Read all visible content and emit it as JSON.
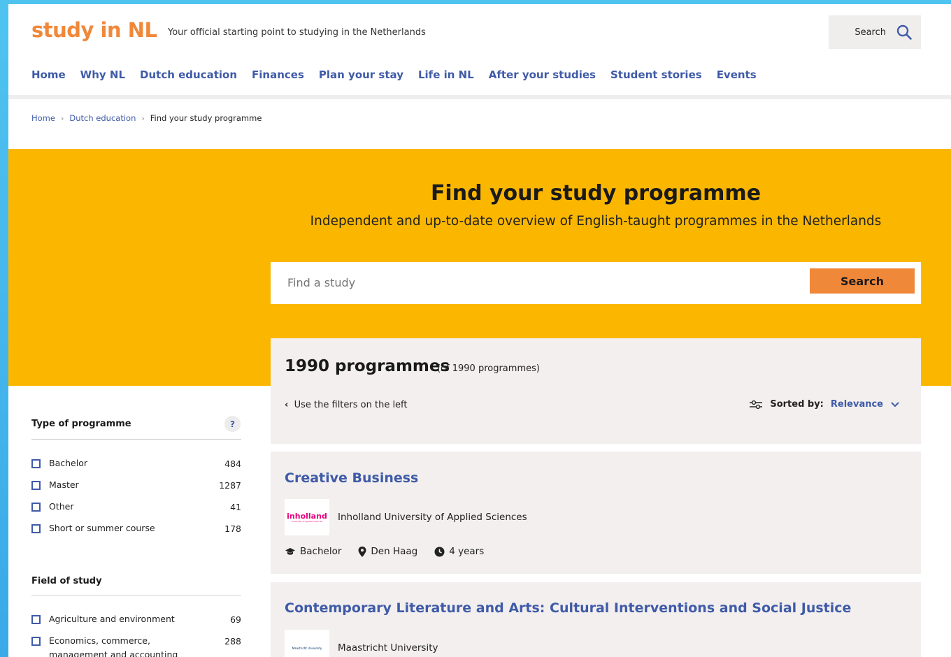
{
  "header": {
    "logo": "study in NL",
    "tagline": "Your official starting point to studying in the Netherlands",
    "search_label": "Search"
  },
  "nav": {
    "items": [
      "Home",
      "Why NL",
      "Dutch education",
      "Finances",
      "Plan your stay",
      "Life in NL",
      "After your studies",
      "Student stories",
      "Events"
    ],
    "active": "Dutch education"
  },
  "breadcrumb": {
    "items": [
      "Home",
      "Dutch education"
    ],
    "current": "Find your study programme"
  },
  "hero": {
    "title": "Find your study programme",
    "subtitle": "Independent and up-to-date overview of English-taught programmes in the Netherlands",
    "search_placeholder": "Find a study",
    "search_button": "Search"
  },
  "filters": {
    "type": {
      "title": "Type of programme",
      "help": "?",
      "options": [
        {
          "label": "Bachelor",
          "count": "484"
        },
        {
          "label": "Master",
          "count": "1287"
        },
        {
          "label": "Other",
          "count": "41"
        },
        {
          "label": "Short or summer course",
          "count": "178"
        }
      ]
    },
    "field": {
      "title": "Field of study",
      "options": [
        {
          "label": "Agriculture and environment",
          "count": "69"
        },
        {
          "label": "Economics, commerce, management and accounting",
          "count": "288"
        }
      ]
    }
  },
  "results": {
    "count": "1990 programmes",
    "count_note": "(of 1990 programmes)",
    "use_filters": "Use the filters on the left",
    "sort_label": "Sorted by:",
    "sort_value": "Relevance"
  },
  "programmes": [
    {
      "title": "Creative Business",
      "university": "Inholland University of Applied Sciences",
      "logo_text": "inholland",
      "logo_sub": "university of applied sciences",
      "type": "Bachelor",
      "location": "Den Haag",
      "duration": "4 years"
    },
    {
      "title": "Contemporary Literature and Arts: Cultural Interventions and Social Justice",
      "university": "Maastricht University",
      "logo_text": "Maastricht University"
    }
  ],
  "colors": {
    "brand_orange": "#f0883a",
    "hero_yellow": "#fbb700",
    "link_blue": "#3f5ba8",
    "card_bg": "#f3efee"
  }
}
